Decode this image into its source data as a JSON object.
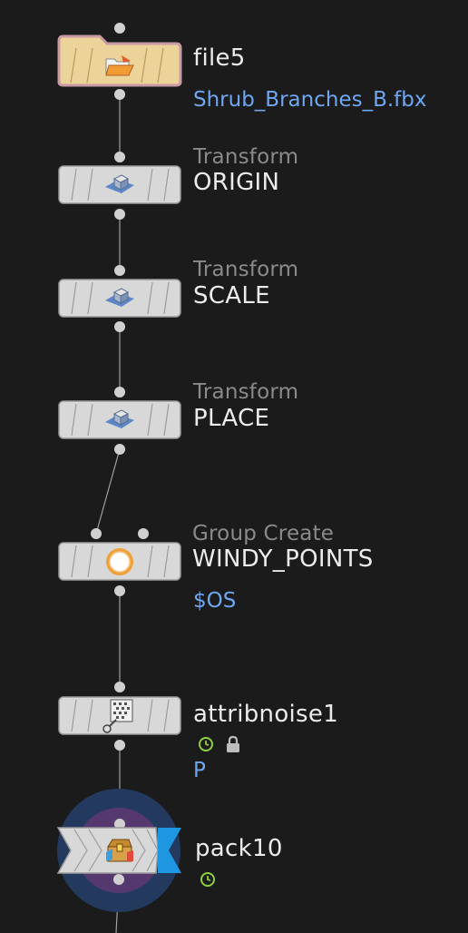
{
  "colors": {
    "background": "#1b1b1b",
    "node_fill": "#d8d8d8",
    "file_node_fill": "#ecd39a",
    "wire": "#a0a0a0",
    "param_text": "#6fa6f0",
    "type_text": "#8a8a8a",
    "name_text": "#ececec",
    "flag_blue": "#1e96e0",
    "clock_green": "#8fce3e"
  },
  "nodes": [
    {
      "id": "file5",
      "type": "",
      "name": "file5",
      "param": "Shrub_Branches_B.fbx",
      "icon": "file-folder-icon"
    },
    {
      "id": "origin",
      "type": "Transform",
      "name": "ORIGIN",
      "param": "",
      "icon": "transform-icon"
    },
    {
      "id": "scale",
      "type": "Transform",
      "name": "SCALE",
      "param": "",
      "icon": "transform-icon"
    },
    {
      "id": "place",
      "type": "Transform",
      "name": "PLACE",
      "param": "",
      "icon": "transform-icon"
    },
    {
      "id": "windy",
      "type": "Group Create",
      "name": "WINDY_POINTS",
      "param": "$OS",
      "icon": "group-create-icon"
    },
    {
      "id": "attribnoise1",
      "type": "",
      "name": "attribnoise1",
      "param": "P",
      "icon": "attribnoise-icon",
      "badges": [
        "time-dependent-clock-icon",
        "lock-icon"
      ]
    },
    {
      "id": "pack10",
      "type": "",
      "name": "pack10",
      "param": "",
      "icon": "pack-chest-icon",
      "badges": [
        "time-dependent-clock-icon"
      ],
      "display_flag": true
    }
  ]
}
